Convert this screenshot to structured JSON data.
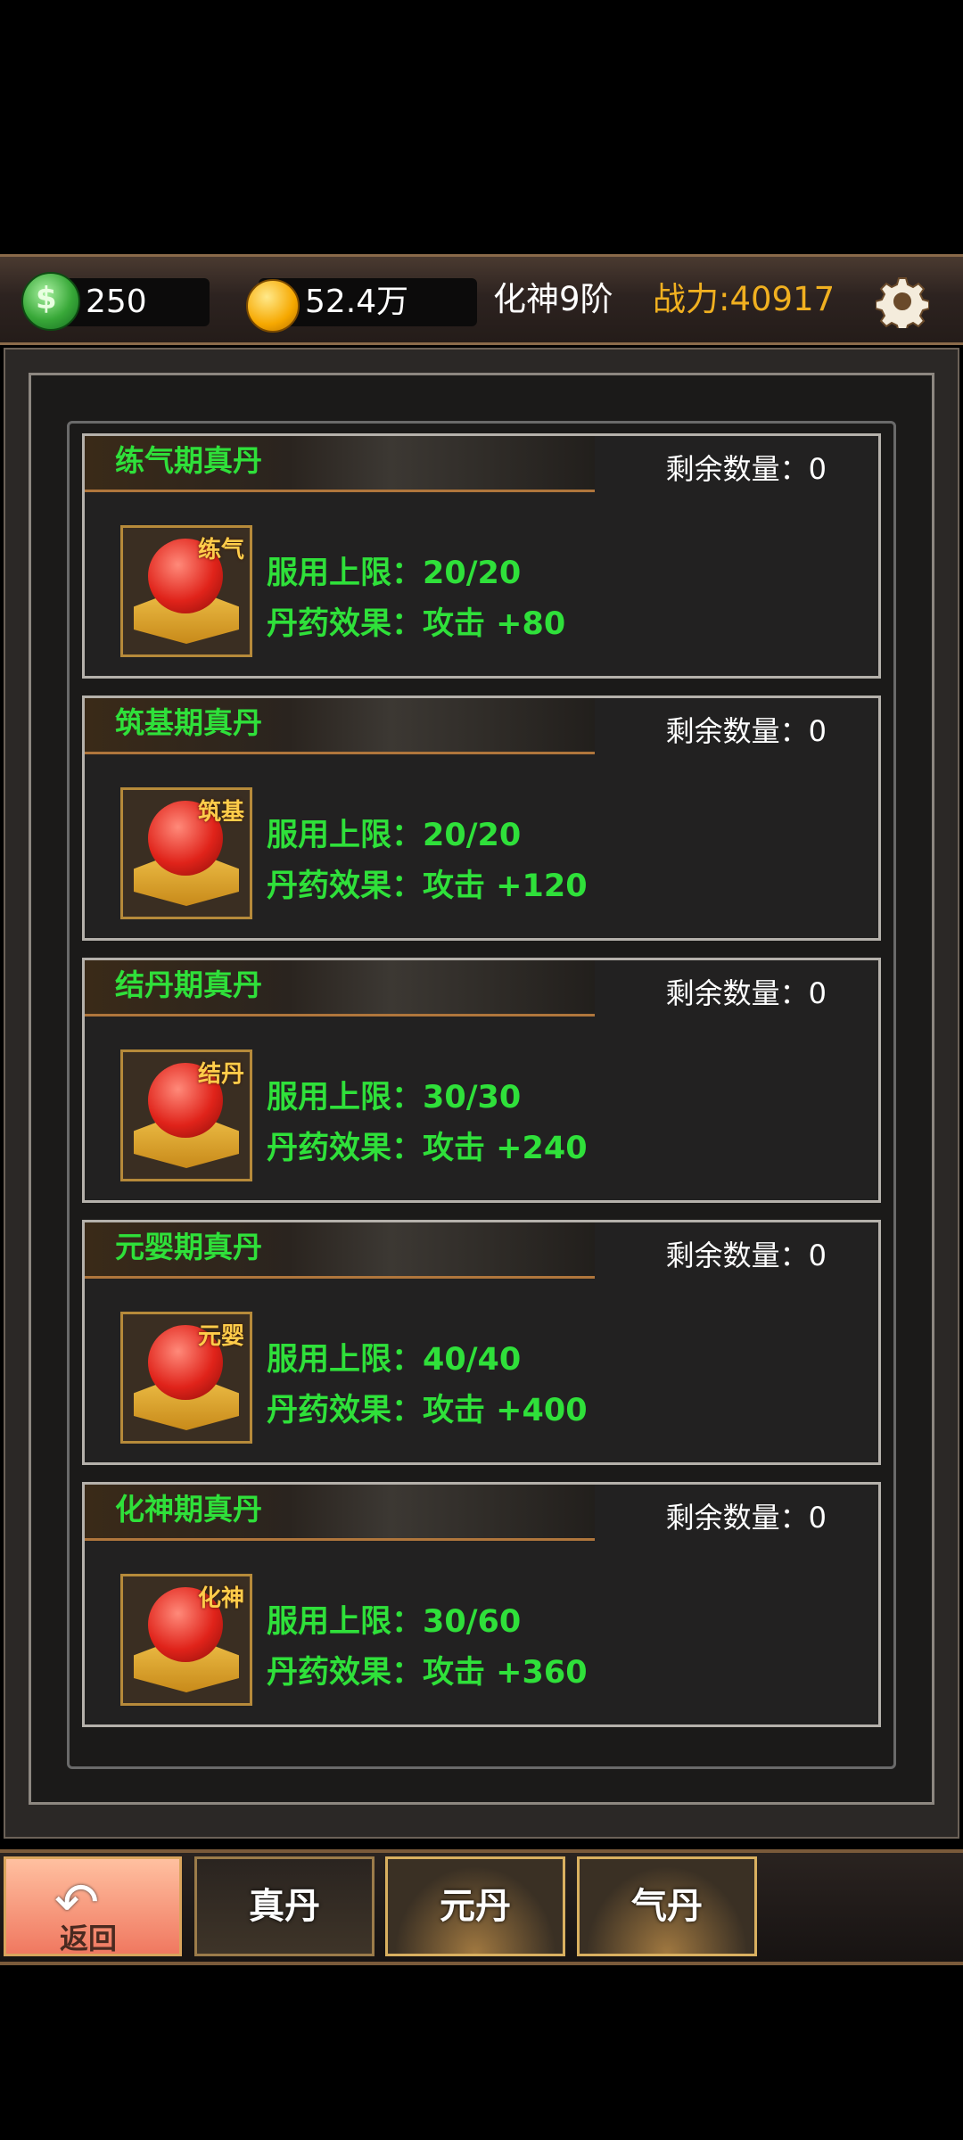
{
  "top_bar": {
    "jade_icon": "jade-gem-icon",
    "jade_count": "250",
    "coin_icon": "gold-coin-icon",
    "gold_amount": "52.4万",
    "realm": "化神9阶",
    "power": "战力:40917",
    "settings_icon": "gear-icon"
  },
  "pills": [
    {
      "title": "练气期真丹",
      "remain": "剩余数量：0",
      "tag": "练气",
      "limit": "服用上限：20/20",
      "effect": "丹药效果：攻击  +80"
    },
    {
      "title": "筑基期真丹",
      "remain": "剩余数量：0",
      "tag": "筑基",
      "limit": "服用上限：20/20",
      "effect": "丹药效果：攻击  +120"
    },
    {
      "title": "结丹期真丹",
      "remain": "剩余数量：0",
      "tag": "结丹",
      "limit": "服用上限：30/30",
      "effect": "丹药效果：攻击  +240"
    },
    {
      "title": "元婴期真丹",
      "remain": "剩余数量：0",
      "tag": "元婴",
      "limit": "服用上限：40/40",
      "effect": "丹药效果：攻击  +400"
    },
    {
      "title": "化神期真丹",
      "remain": "剩余数量：0",
      "tag": "化神",
      "limit": "服用上限：30/60",
      "effect": "丹药效果：攻击  +360"
    }
  ],
  "bottom": {
    "back_label": "返回",
    "tabs": [
      {
        "label": "真丹"
      },
      {
        "label": "元丹"
      },
      {
        "label": "气丹"
      }
    ]
  }
}
